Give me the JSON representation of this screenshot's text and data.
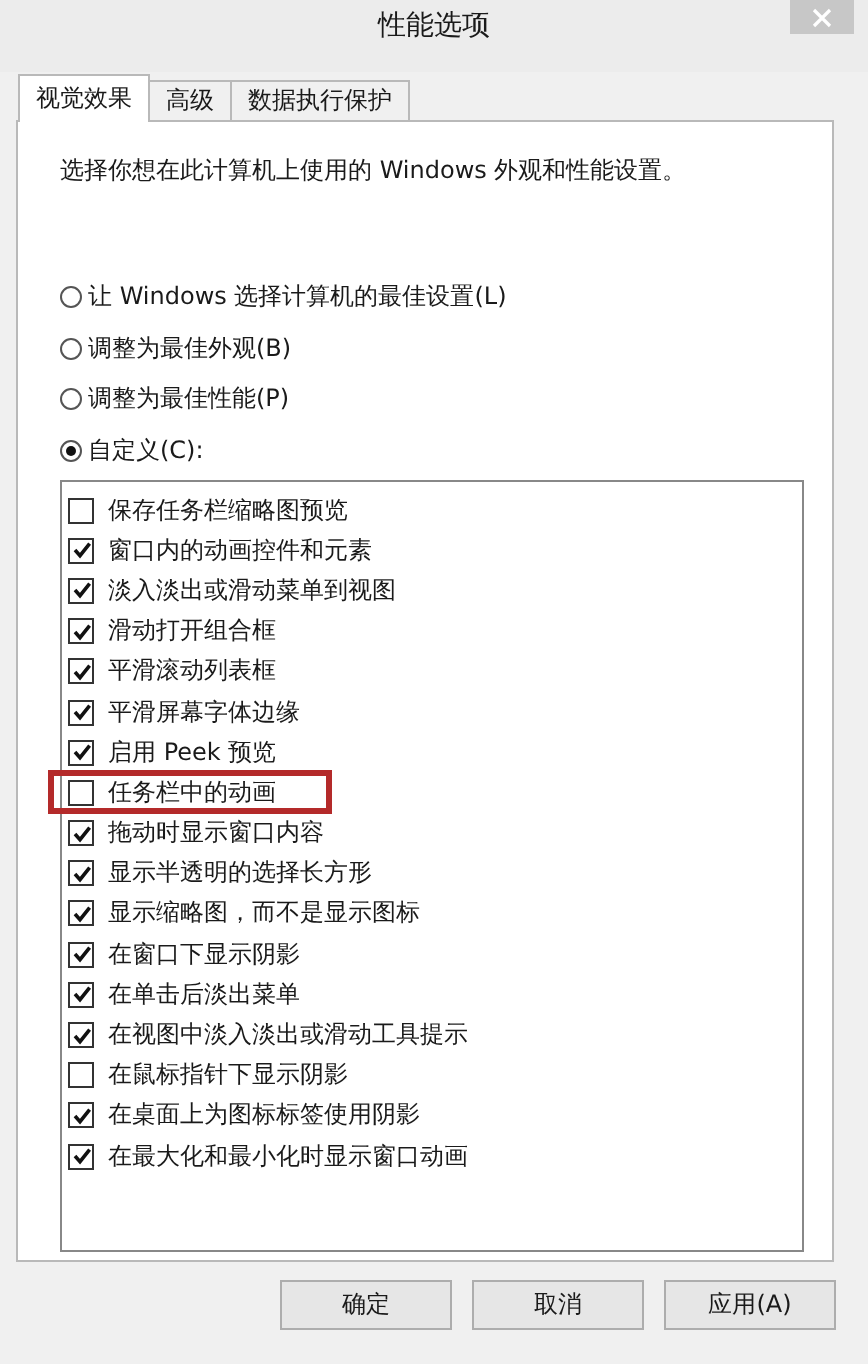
{
  "window": {
    "title": "性能选项"
  },
  "tabs": [
    {
      "label": "视觉效果",
      "selected": true
    },
    {
      "label": "高级",
      "selected": false
    },
    {
      "label": "数据执行保护",
      "selected": false
    }
  ],
  "description": "选择你想在此计算机上使用的 Windows 外观和性能设置。",
  "radios": [
    {
      "label": "让 Windows 选择计算机的最佳设置(L)",
      "selected": false
    },
    {
      "label": "调整为最佳外观(B)",
      "selected": false
    },
    {
      "label": "调整为最佳性能(P)",
      "selected": false
    },
    {
      "label": "自定义(C):",
      "selected": true
    }
  ],
  "options": [
    {
      "label": "保存任务栏缩略图预览",
      "checked": false,
      "highlighted": false
    },
    {
      "label": "窗口内的动画控件和元素",
      "checked": true,
      "highlighted": false
    },
    {
      "label": "淡入淡出或滑动菜单到视图",
      "checked": true,
      "highlighted": false
    },
    {
      "label": "滑动打开组合框",
      "checked": true,
      "highlighted": false
    },
    {
      "label": "平滑滚动列表框",
      "checked": true,
      "highlighted": false
    },
    {
      "label": "平滑屏幕字体边缘",
      "checked": true,
      "highlighted": false
    },
    {
      "label": "启用 Peek 预览",
      "checked": true,
      "highlighted": false
    },
    {
      "label": "任务栏中的动画",
      "checked": false,
      "highlighted": true
    },
    {
      "label": "拖动时显示窗口内容",
      "checked": true,
      "highlighted": false
    },
    {
      "label": "显示半透明的选择长方形",
      "checked": true,
      "highlighted": false
    },
    {
      "label": "显示缩略图，而不是显示图标",
      "checked": true,
      "highlighted": false
    },
    {
      "label": "在窗口下显示阴影",
      "checked": true,
      "highlighted": false
    },
    {
      "label": "在单击后淡出菜单",
      "checked": true,
      "highlighted": false
    },
    {
      "label": "在视图中淡入淡出或滑动工具提示",
      "checked": true,
      "highlighted": false
    },
    {
      "label": "在鼠标指针下显示阴影",
      "checked": false,
      "highlighted": false
    },
    {
      "label": "在桌面上为图标标签使用阴影",
      "checked": true,
      "highlighted": false
    },
    {
      "label": "在最大化和最小化时显示窗口动画",
      "checked": true,
      "highlighted": false
    }
  ],
  "buttons": [
    "确定",
    "取消",
    "应用(A)"
  ]
}
